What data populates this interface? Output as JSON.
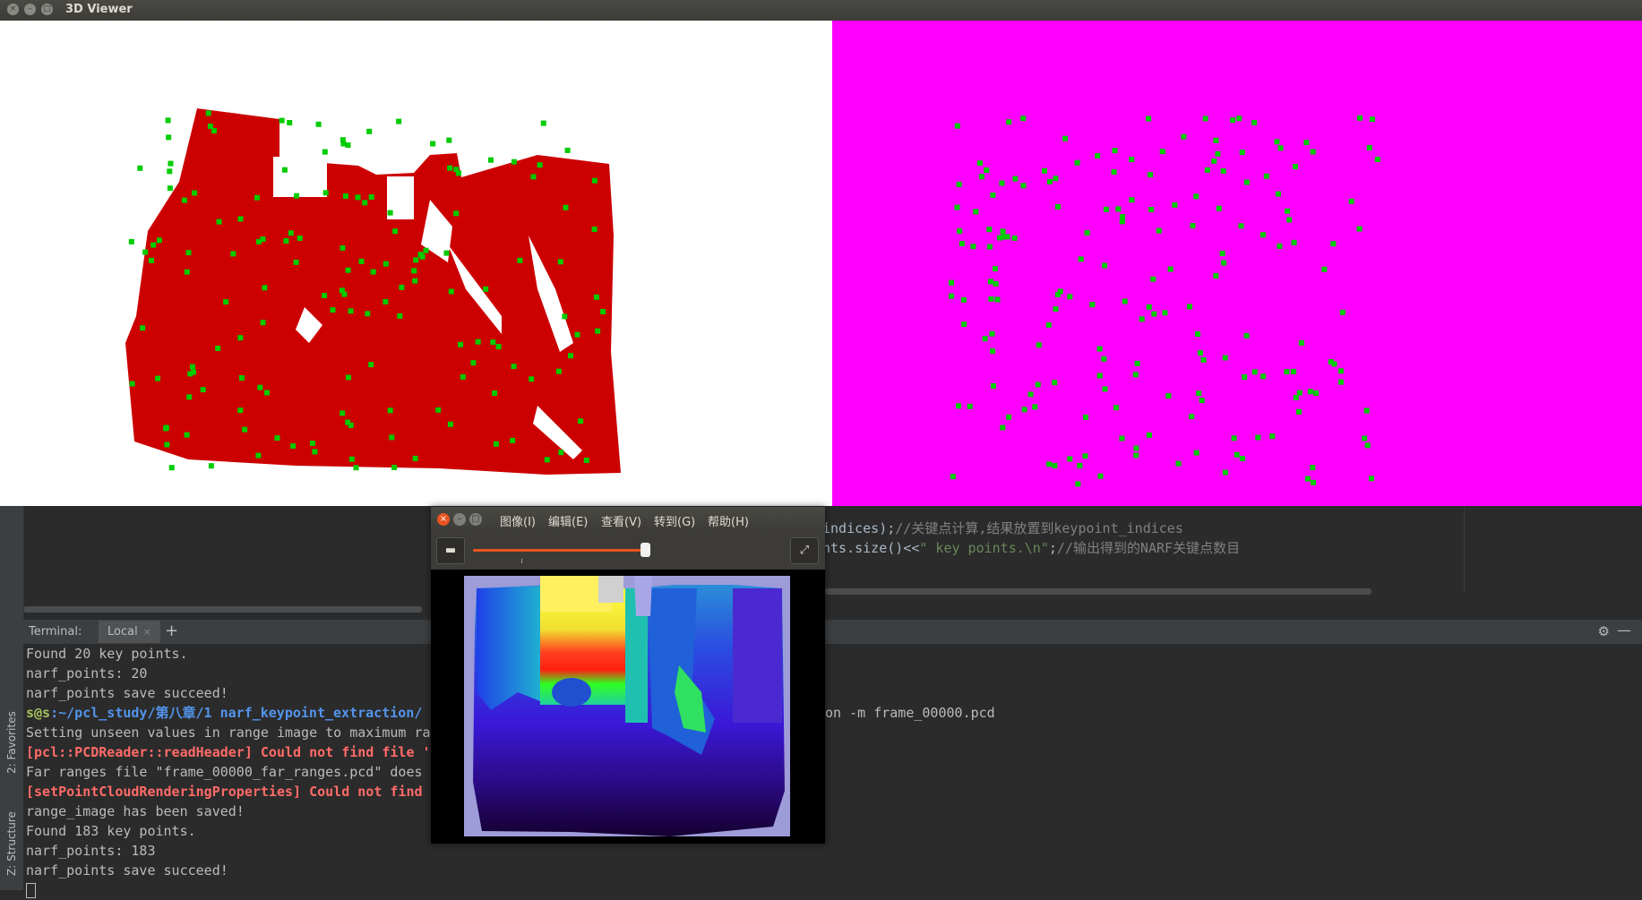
{
  "viewer": {
    "title": "3D Viewer",
    "left_bg": "#ffffff",
    "right_bg": "#ff00ff",
    "cloud_color": "#cc0000",
    "keypoint_color": "#00cc00"
  },
  "image_window": {
    "menu": [
      "图像(I)",
      "编辑(E)",
      "查看(V)",
      "转到(G)",
      "帮助(H)"
    ],
    "zoom_level": 0.93
  },
  "editor": {
    "line1_code": "indices);",
    "line1_comment": "//关键点计算,结果放置到keypoint_indices",
    "line2_code": "nts.size()<<",
    "line2_string": "\" key points.\\n\"",
    "line2_end": ";",
    "line2_comment": "//输出得到的NARF关键点数目"
  },
  "side_tabs": {
    "favorites": "2: Favorites",
    "structure": "Z: Structure"
  },
  "terminal": {
    "label": "Terminal:",
    "tab": "Local",
    "lines": [
      "Found 20 key points.",
      "narf_points: 20",
      "narf_points save succeed!"
    ],
    "prompt_user": "s@s",
    "prompt_path": ":~/pcl_study/第八章/1 narf_keypoint_extraction/",
    "prompt_tail": "ion -m frame_00000.pcd",
    "line_setting": "Setting unseen values in range image to maximum ra",
    "line_err1": "[pcl::PCDReader::readHeader] Could not find file '",
    "line_far": "Far ranges file \"frame_00000_far_ranges.pcd\" does",
    "line_err2": "[setPointCloudRenderingProperties] Could not find",
    "lines2": [
      "range_image has been saved!",
      "Found 183 key points.",
      "narf_points: 183",
      "narf_points save succeed!"
    ]
  }
}
